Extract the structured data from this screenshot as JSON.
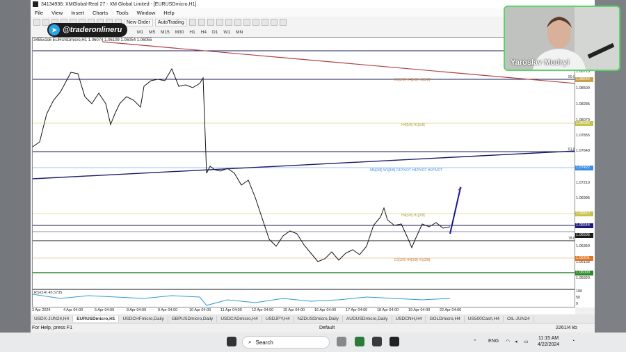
{
  "window": {
    "title": "34134936: XMGlobal-Real 27 - XM Global Limited - [EURUSDmicro,H1]"
  },
  "menu": [
    "File",
    "View",
    "Insert",
    "Charts",
    "Tools",
    "Window",
    "Help"
  ],
  "toolbar": {
    "new_order": "New Order",
    "autotrading": "AutoTrading"
  },
  "timeframes": [
    "M1",
    "M5",
    "M15",
    "M30",
    "H1",
    "H4",
    "D1",
    "W1",
    "MN"
  ],
  "watermark": "@traderonlineru",
  "chart": {
    "header": "EURUSDmicro,H1  1.06074 1.06109 1.06054 1.06055",
    "id_label": "3455x1s6",
    "level_labels": {
      "top": "D1[5/8] H4[5/8] H1[5/8]",
      "mid": "H4[5/8] H1[5/8]",
      "pivot": "MN[3/8] W1[8/8] D1PIVOT H4PIVOT H1PIVOT",
      "low": "H4[3/8] H1[3/8]",
      "bottom": "D1[3/8] H4[3/8] H1[3/8]"
    },
    "fib_labels": [
      "50.0",
      "61.8",
      "78.6"
    ]
  },
  "price_axis": {
    "ticks": [
      "1.08713",
      "1.08500",
      "1.08285",
      "1.08070",
      "1.07855",
      "1.07640",
      "1.07422",
      "1.07210",
      "1.06995",
      "1.06780",
      "1.06565",
      "1.06350",
      "1.06135",
      "1.05920"
    ],
    "boxes": [
      {
        "text": "1.08642",
        "color": "#c8a24a"
      },
      {
        "text": "1.08032",
        "color": "#c8c24a"
      },
      {
        "text": "1.07422",
        "color": "#3a8ee6"
      },
      {
        "text": "1.06812",
        "color": "#c8c24a"
      },
      {
        "text": "1.06644",
        "color": "#1a1a7a"
      },
      {
        "text": "1.06505",
        "color": "#1a1a1a"
      },
      {
        "text": "1.06201",
        "color": "#e0782a"
      },
      {
        "text": "1.06000",
        "color": "#2a8a2a"
      }
    ]
  },
  "rsi": {
    "label": "RSI(14) 45.5735",
    "ticks": [
      "100",
      "50",
      "0"
    ]
  },
  "time_axis": [
    "3 Apr 2024",
    "4 Apr 04:00",
    "5 Apr 04:00",
    "8 Apr 04:00",
    "9 Apr 04:00",
    "10 Apr 04:00",
    "11 Apr 04:00",
    "12 Apr 04:00",
    "15 Apr 04:00",
    "16 Apr 04:00",
    "17 Apr 04:00",
    "18 Apr 04:00",
    "19 Apr 04:00",
    "22 Apr 04:00"
  ],
  "tabs": [
    "USDX-JUN24,H4",
    "EURUSDmicro,H1",
    "USDCHFmicro,Daily",
    "GBPUSDmicro,Daily",
    "USDCADmicro,H4",
    "USDJPY,H4",
    "NZDUSDmicro,Daily",
    "AUDUSDmicro,Daily",
    "USDCNH,H4",
    "GOLDmicro,H4",
    "US500Cash,H4",
    "OIL-JUN24"
  ],
  "active_tab": "EURUSDmicro,H1",
  "status": {
    "help": "For Help, press F1",
    "profile": "Default",
    "traffic": "2261/4 kb"
  },
  "taskbar": {
    "search_placeholder": "Search",
    "lang": "ENG",
    "time": "11:15 AM",
    "date": "4/22/2024"
  },
  "webcam": {
    "name": "Yaroslav Mudryi"
  }
}
